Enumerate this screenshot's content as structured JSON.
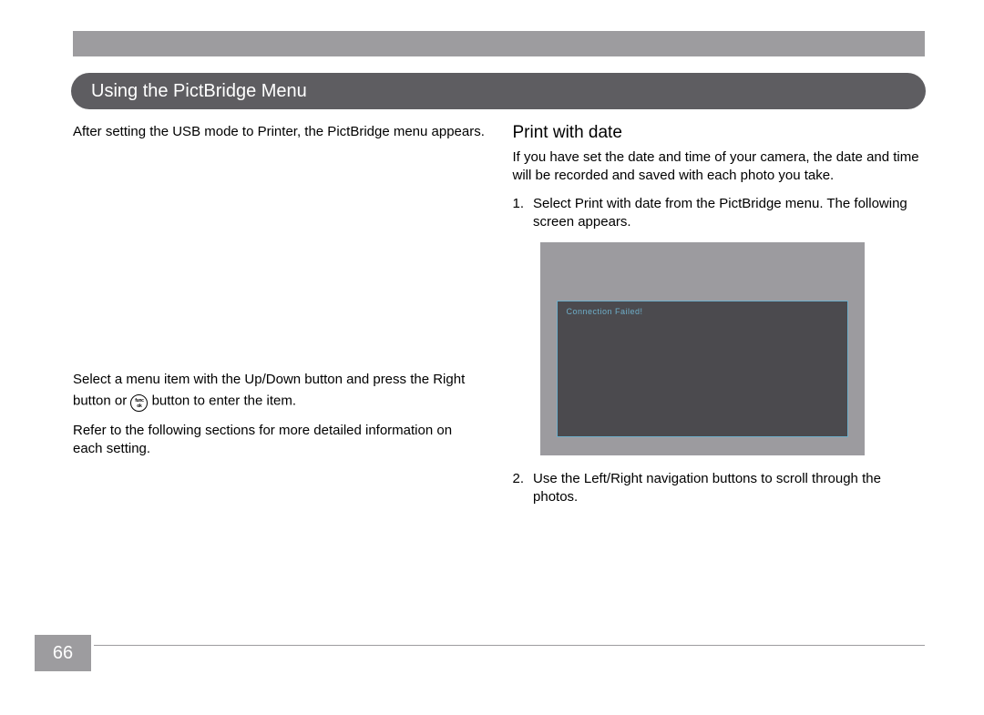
{
  "section_title": "Using the PictBridge Menu",
  "left": {
    "intro": "After setting the USB mode to Printer, the PictBridge menu appears.",
    "menu_instruction_pre": "Select a menu item with the Up/Down button and press the Right button or ",
    "menu_instruction_post": " button to enter the item.",
    "icon_top_label": "func",
    "icon_bottom_label": "ok",
    "refer": "Refer to the following sections for more detailed information on each setting."
  },
  "right": {
    "subheading": "Print with date",
    "intro": "If you have set the date and time of your camera, the date and time will be recorded and saved with each photo you take.",
    "step1_num": "1.",
    "step1_text": "Select Print with date from the PictBridge menu.  The following screen appears.",
    "screenshot_msg": "Connection Failed!",
    "step2_num": "2.",
    "step2_text": "Use the Left/Right navigation buttons to scroll through the photos."
  },
  "page_number": "66"
}
